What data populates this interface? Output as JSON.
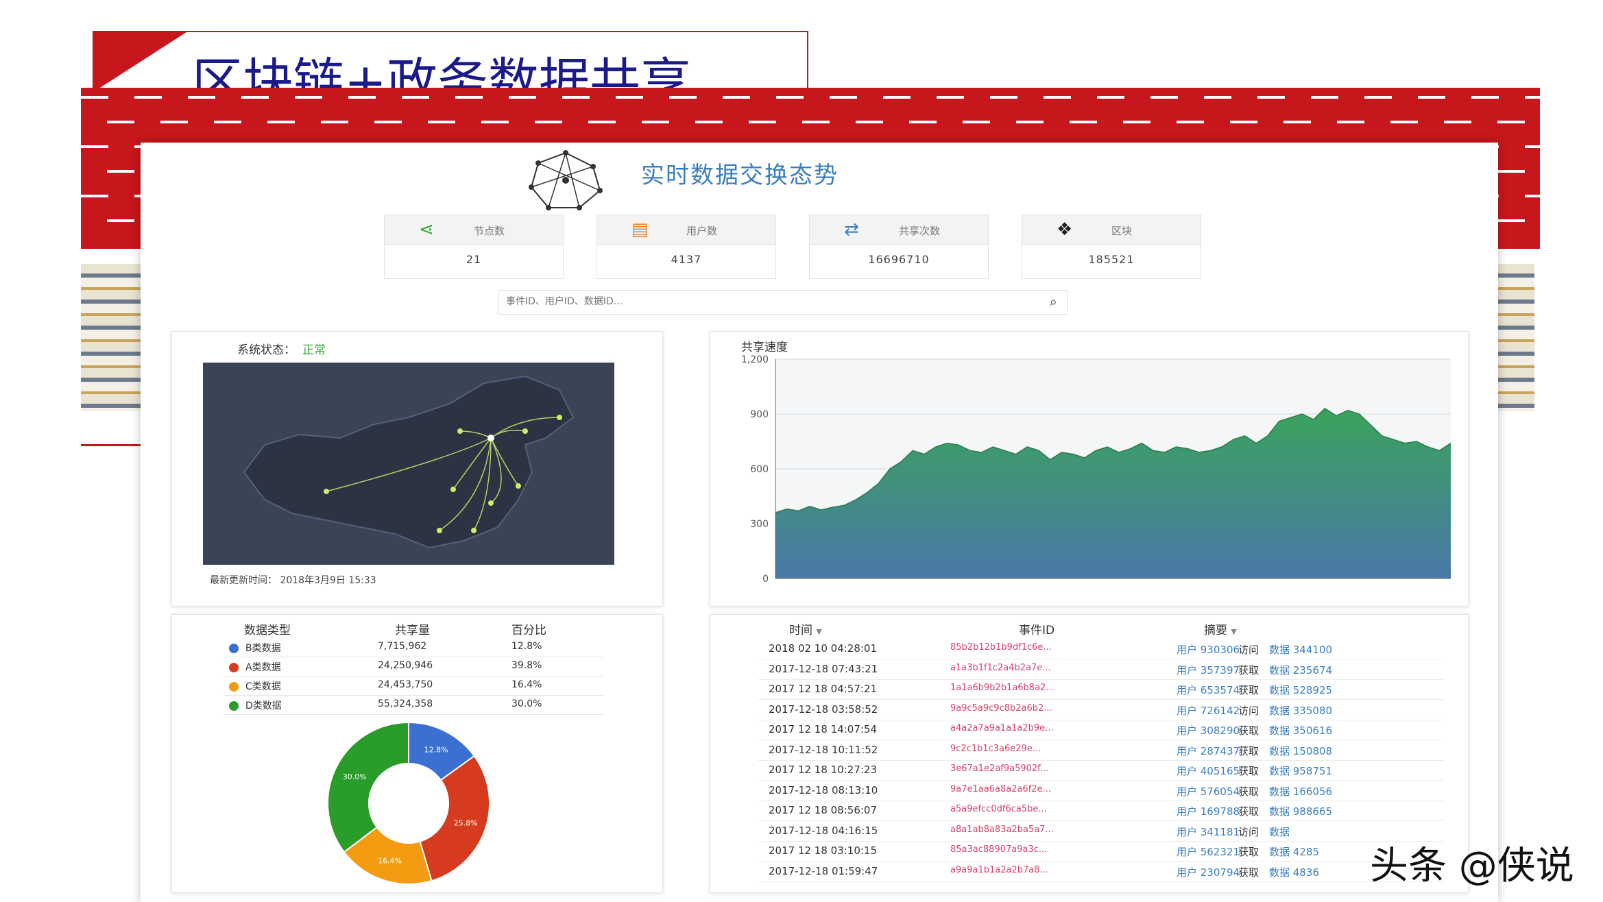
{
  "slide": {
    "title": "区块链+政务数据共享"
  },
  "dashboard": {
    "title": "实时数据交换态势",
    "stats": [
      {
        "label": "节点数",
        "value": "21",
        "icon": "share-icon"
      },
      {
        "label": "用户数",
        "value": "4137",
        "icon": "id-card-icon"
      },
      {
        "label": "共享次数",
        "value": "16696710",
        "icon": "exchange-icon"
      },
      {
        "label": "区块",
        "value": "185521",
        "icon": "blocks-icon"
      }
    ],
    "search": {
      "placeholder": "事件ID、用户ID、数据ID..."
    }
  },
  "map": {
    "status_label": "系统状态：",
    "status_value": "正常",
    "update_text": "最新更新时间：  2018年3月9日  15:33"
  },
  "share_chart": {
    "title": "共享速度"
  },
  "share_table": {
    "headers": [
      "数据类型",
      "共享量",
      "百分比"
    ],
    "rows": [
      {
        "type": "B类数据",
        "amount": "7,715,962",
        "pct": "12.8%",
        "color": "#3b6fd1"
      },
      {
        "type": "A类数据",
        "amount": "24,250,946",
        "pct": "39.8%",
        "color": "#d63b1f"
      },
      {
        "type": "C类数据",
        "amount": "24,453,750",
        "pct": "16.4%",
        "color": "#f39c12"
      },
      {
        "type": "D类数据",
        "amount": "55,324,358",
        "pct": "30.0%",
        "color": "#2a9c2a"
      }
    ]
  },
  "tx_table": {
    "headers": [
      "时间",
      "事件ID",
      "摘要"
    ],
    "rows": [
      {
        "time": "2018 02 10 04:28:01",
        "hash": "85b2b12b1b9df1c6e...",
        "user": "用户 930306",
        "action": "访问",
        "data": "数据 344100"
      },
      {
        "time": "2017-12-18 07:43:21",
        "hash": "a1a3b1f1c2a4b2a7e...",
        "user": "用户 357397",
        "action": "获取",
        "data": "数据 235674"
      },
      {
        "time": "2017 12 18 04:57:21",
        "hash": "1a1a6b9b2b1a6b8a2...",
        "user": "用户 653574",
        "action": "获取",
        "data": "数据 528925"
      },
      {
        "time": "2017-12-18 03:58:52",
        "hash": "9a9c5a9c9c8b2a6b2...",
        "user": "用户 726142",
        "action": "访问",
        "data": "数据 335080"
      },
      {
        "time": "2017 12 18 14:07:54",
        "hash": "a4a2a7a9a1a1a2b9e...",
        "user": "用户 308290",
        "action": "获取",
        "data": "数据 350616"
      },
      {
        "time": "2017-12-18 10:11:52",
        "hash": "9c2c1b1c3a6e29e...",
        "user": "用户 287437",
        "action": "获取",
        "data": "数据 150808"
      },
      {
        "time": "2017 12 18 10:27:23",
        "hash": "3e67a1e2af9a5902f...",
        "user": "用户 405165",
        "action": "获取",
        "data": "数据 958751"
      },
      {
        "time": "2017-12-18 08:13:10",
        "hash": "9a7e1aa6a8a2a6f2e...",
        "user": "用户 576054",
        "action": "获取",
        "data": "数据 166056"
      },
      {
        "time": "2017 12 18 08:56:07",
        "hash": "a5a9efcc0df6ca5be...",
        "user": "用户 169788",
        "action": "获取",
        "data": "数据 988665"
      },
      {
        "time": "2017-12-18 04:16:15",
        "hash": "a8a1ab8a83a2ba5a7...",
        "user": "用户 341181",
        "action": "访问",
        "data": "数据"
      },
      {
        "time": "2017 12 18 03:10:15",
        "hash": "85a3ac88907a9a3c...",
        "user": "用户 562321",
        "action": "获取",
        "data": "数据 4285"
      },
      {
        "time": "2017-12-18 01:59:47",
        "hash": "a9a9a1b1a2a2b7a8...",
        "user": "用户 230794",
        "action": "获取",
        "data": "数据 4836"
      }
    ]
  },
  "watermark": "头条 @侠说",
  "chart_data": [
    {
      "type": "area",
      "title": "共享速度",
      "ylim": [
        0,
        1200
      ],
      "yticks": [
        "0",
        "300",
        "600",
        "900",
        "1,200"
      ],
      "x": [
        0,
        1,
        2,
        3,
        4,
        5,
        6,
        7,
        8,
        9,
        10,
        11,
        12,
        13,
        14,
        15,
        16,
        17,
        18,
        19,
        20,
        21,
        22,
        23,
        24,
        25,
        26,
        27,
        28,
        29,
        30,
        31,
        32,
        33,
        34,
        35,
        36,
        37,
        38,
        39,
        40,
        41,
        42,
        43,
        44,
        45,
        46,
        47,
        48,
        49,
        50,
        51,
        52,
        53,
        54,
        55,
        56,
        57,
        58,
        59
      ],
      "values": [
        360,
        380,
        370,
        395,
        375,
        390,
        400,
        430,
        470,
        520,
        600,
        640,
        700,
        680,
        720,
        740,
        730,
        700,
        690,
        720,
        700,
        680,
        720,
        700,
        650,
        690,
        680,
        660,
        700,
        720,
        690,
        710,
        740,
        700,
        690,
        720,
        710,
        690,
        700,
        720,
        760,
        780,
        740,
        780,
        860,
        880,
        900,
        870,
        930,
        890,
        920,
        900,
        840,
        780,
        760,
        740,
        750,
        720,
        700,
        740
      ],
      "colors": {
        "top": "#3aa35c",
        "bottom": "#4a78a8"
      }
    },
    {
      "type": "pie",
      "donut": true,
      "categories": [
        "B类数据",
        "A类数据",
        "C类数据",
        "D类数据"
      ],
      "values": [
        12.8,
        25.8,
        16.4,
        30.0
      ],
      "labels": [
        "12.8%",
        "25.8%",
        "16.4%",
        "30.0%"
      ],
      "colors": [
        "#3b6fd1",
        "#d63b1f",
        "#f39c12",
        "#2a9c2a"
      ]
    }
  ]
}
